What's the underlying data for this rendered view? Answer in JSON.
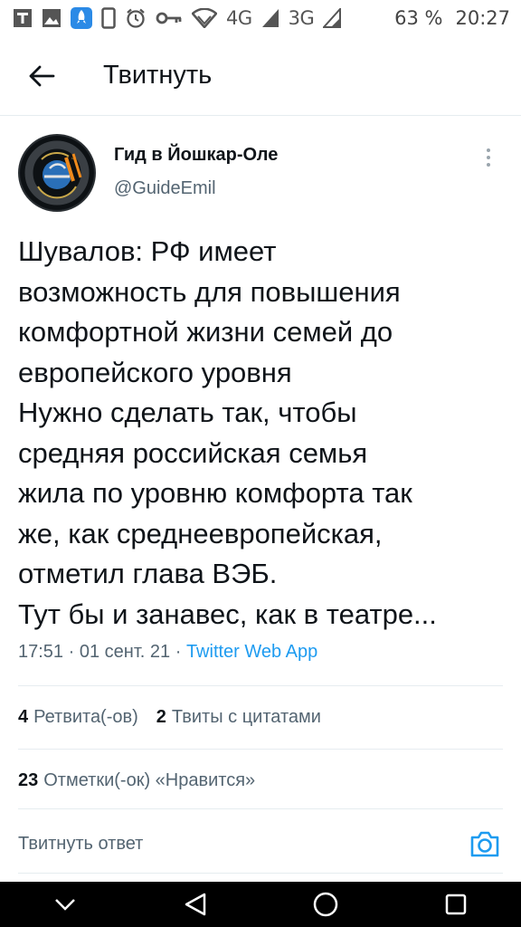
{
  "status_bar": {
    "network_4g": "4G",
    "network_3g": "3G",
    "battery": "63 %",
    "time": "20:27"
  },
  "header": {
    "title": "Твитнуть"
  },
  "tweet": {
    "author": {
      "display_name": "Гид в Йошкар-Оле",
      "handle": "@GuideEmil"
    },
    "text": "Шувалов: РФ имеет\nвозможность для повышения\nкомфортной жизни семей до\nевропейского уровня\nНужно сделать так, чтобы\nсредняя российская семья\nжила по уровню комфорта так\nже, как среднеевропейская,\nотметил глава ВЭБ.\nТут бы и занавес, как в театре...",
    "time": "17:51",
    "date": "01 сент. 21",
    "separator": "·",
    "source_app": "Twitter Web App"
  },
  "stats": {
    "retweets_count": "4",
    "retweets_label": "Ретвита(-ов)",
    "quotes_count": "2",
    "quotes_label": "Твиты с цитатами",
    "likes_count": "23",
    "likes_label": "Отметки(-ок) «Нравится»"
  },
  "reply": {
    "placeholder": "Твитнуть ответ"
  },
  "colors": {
    "accent": "#1d9bf0",
    "text": "#0f1419",
    "muted": "#536471",
    "divider": "#e6ecf0"
  },
  "icons": {
    "back": "arrow-left-icon",
    "more": "more-vertical-icon",
    "camera": "camera-icon"
  }
}
